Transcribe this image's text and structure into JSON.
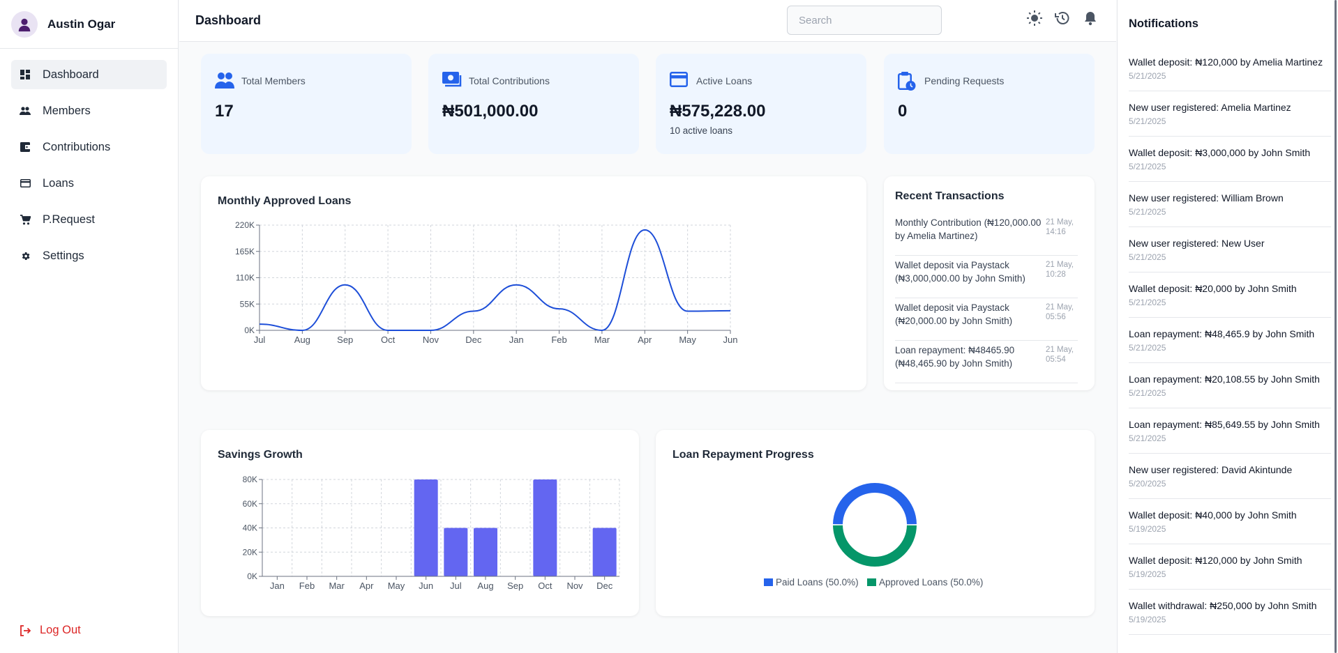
{
  "user": {
    "name": "Austin Ogar"
  },
  "sidebar": {
    "items": [
      {
        "label": "Dashboard",
        "icon": "dashboard-icon",
        "active": true
      },
      {
        "label": "Members",
        "icon": "members-icon"
      },
      {
        "label": "Contributions",
        "icon": "wallet-icon"
      },
      {
        "label": "Loans",
        "icon": "card-icon"
      },
      {
        "label": "P.Request",
        "icon": "cart-icon"
      },
      {
        "label": "Settings",
        "icon": "gear-icon"
      }
    ],
    "logout_label": "Log Out"
  },
  "header": {
    "title": "Dashboard",
    "search_placeholder": "Search",
    "icons": [
      "sun-icon",
      "history-icon",
      "bell-icon"
    ]
  },
  "stats": [
    {
      "label": "Total Members",
      "value": "17",
      "sub": "",
      "icon": "people-icon"
    },
    {
      "label": "Total Contributions",
      "value": "₦501,000.00",
      "sub": "",
      "icon": "money-icon"
    },
    {
      "label": "Active Loans",
      "value": "₦575,228.00",
      "sub": "10 active loans",
      "icon": "card-icon"
    },
    {
      "label": "Pending Requests",
      "value": "0",
      "sub": "",
      "icon": "clipboard-clock-icon"
    }
  ],
  "colors": {
    "line": "#1d4ed8",
    "bar": "#6366f1",
    "paid": "#2563eb",
    "approved": "#059669",
    "accent_bg": "#eff6ff"
  },
  "transactions": {
    "title": "Recent Transactions",
    "items": [
      {
        "desc": "Monthly Contribution (₦120,000.00 by Amelia Martinez)",
        "time": "21 May, 14:16"
      },
      {
        "desc": "Wallet deposit via Paystack (₦3,000,000.00 by John Smith)",
        "time": "21 May, 10:28"
      },
      {
        "desc": "Wallet deposit via Paystack (₦20,000.00 by John Smith)",
        "time": "21 May, 05:56"
      },
      {
        "desc": "Loan repayment: ₦48465.90 (₦48,465.90 by John Smith)",
        "time": "21 May, 05:54"
      }
    ]
  },
  "notifications": {
    "title": "Notifications",
    "items": [
      {
        "text": "Wallet deposit: ₦120,000 by Amelia Martinez",
        "date": "5/21/2025"
      },
      {
        "text": "New user registered: Amelia Martinez",
        "date": "5/21/2025"
      },
      {
        "text": "Wallet deposit: ₦3,000,000 by John Smith",
        "date": "5/21/2025"
      },
      {
        "text": "New user registered: William Brown",
        "date": "5/21/2025"
      },
      {
        "text": "New user registered: New User",
        "date": "5/21/2025"
      },
      {
        "text": "Wallet deposit: ₦20,000 by John Smith",
        "date": "5/21/2025"
      },
      {
        "text": "Loan repayment: ₦48,465.9 by John Smith",
        "date": "5/21/2025"
      },
      {
        "text": "Loan repayment: ₦20,108.55 by John Smith",
        "date": "5/21/2025"
      },
      {
        "text": "Loan repayment: ₦85,649.55 by John Smith",
        "date": "5/21/2025"
      },
      {
        "text": "New user registered: David Akintunde",
        "date": "5/20/2025"
      },
      {
        "text": "Wallet deposit: ₦40,000 by John Smith",
        "date": "5/19/2025"
      },
      {
        "text": "Wallet deposit: ₦120,000 by John Smith",
        "date": "5/19/2025"
      },
      {
        "text": "Wallet withdrawal: ₦250,000 by John Smith",
        "date": "5/19/2025"
      }
    ]
  },
  "chart_data": [
    {
      "type": "line",
      "title": "Monthly Approved Loans",
      "categories": [
        "Jul",
        "Aug",
        "Sep",
        "Oct",
        "Nov",
        "Dec",
        "Jan",
        "Feb",
        "Mar",
        "Apr",
        "May",
        "Jun"
      ],
      "values": [
        13000,
        0,
        95000,
        0,
        0,
        40000,
        95000,
        45000,
        0,
        210000,
        40000,
        41000
      ],
      "ylim": [
        0,
        220000
      ],
      "yticks": [
        "0K",
        "55K",
        "110K",
        "165K",
        "220K"
      ],
      "grid": true
    },
    {
      "type": "bar",
      "title": "Savings Growth",
      "categories": [
        "Jan",
        "Feb",
        "Mar",
        "Apr",
        "May",
        "Jun",
        "Jul",
        "Aug",
        "Sep",
        "Oct",
        "Nov",
        "Dec"
      ],
      "values": [
        0,
        0,
        0,
        0,
        0,
        80000,
        40000,
        40000,
        0,
        80000,
        0,
        40000
      ],
      "ylim": [
        0,
        80000
      ],
      "yticks": [
        "0K",
        "20K",
        "40K",
        "60K",
        "80K"
      ],
      "grid": true
    },
    {
      "type": "pie",
      "title": "Loan Repayment Progress",
      "slices": [
        {
          "label": "Paid Loans (50.0%)",
          "value": 50.0
        },
        {
          "label": "Approved Loans (50.0%)",
          "value": 50.0
        }
      ],
      "legend": "bottom"
    }
  ]
}
